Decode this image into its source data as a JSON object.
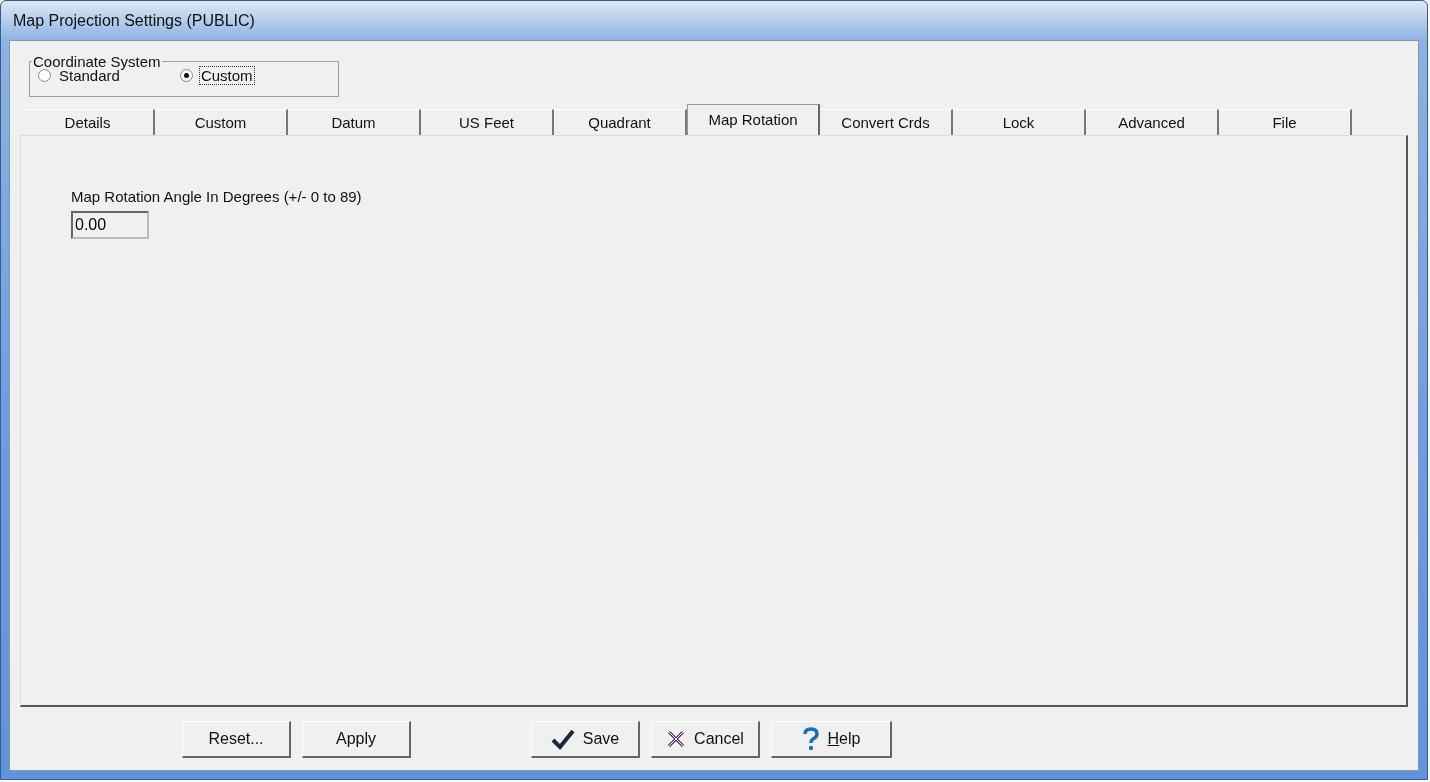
{
  "window": {
    "title": "Map Projection Settings (PUBLIC)"
  },
  "coordinate_system": {
    "label": "Coordinate System",
    "options": [
      {
        "label": "Standard",
        "selected": false
      },
      {
        "label": "Custom",
        "selected": true
      }
    ]
  },
  "tabs": [
    {
      "label": "Details",
      "selected": false
    },
    {
      "label": "Custom",
      "selected": false
    },
    {
      "label": "Datum",
      "selected": false
    },
    {
      "label": "US Feet",
      "selected": false
    },
    {
      "label": "Quadrant",
      "selected": false
    },
    {
      "label": "Map Rotation",
      "selected": true
    },
    {
      "label": "Convert Crds",
      "selected": false
    },
    {
      "label": "Lock",
      "selected": false
    },
    {
      "label": "Advanced",
      "selected": false
    },
    {
      "label": "File",
      "selected": false
    }
  ],
  "rotation": {
    "label": "Map Rotation Angle  In Degrees (+/- 0 to 89)",
    "value": "0.00"
  },
  "buttons": [
    {
      "label": "Reset...",
      "kind": "plain"
    },
    {
      "label": "Apply",
      "kind": "plain"
    },
    {
      "label": "Save",
      "kind": "check"
    },
    {
      "label": "Cancel",
      "kind": "cross"
    },
    {
      "label": "Help",
      "kind": "question"
    }
  ]
}
